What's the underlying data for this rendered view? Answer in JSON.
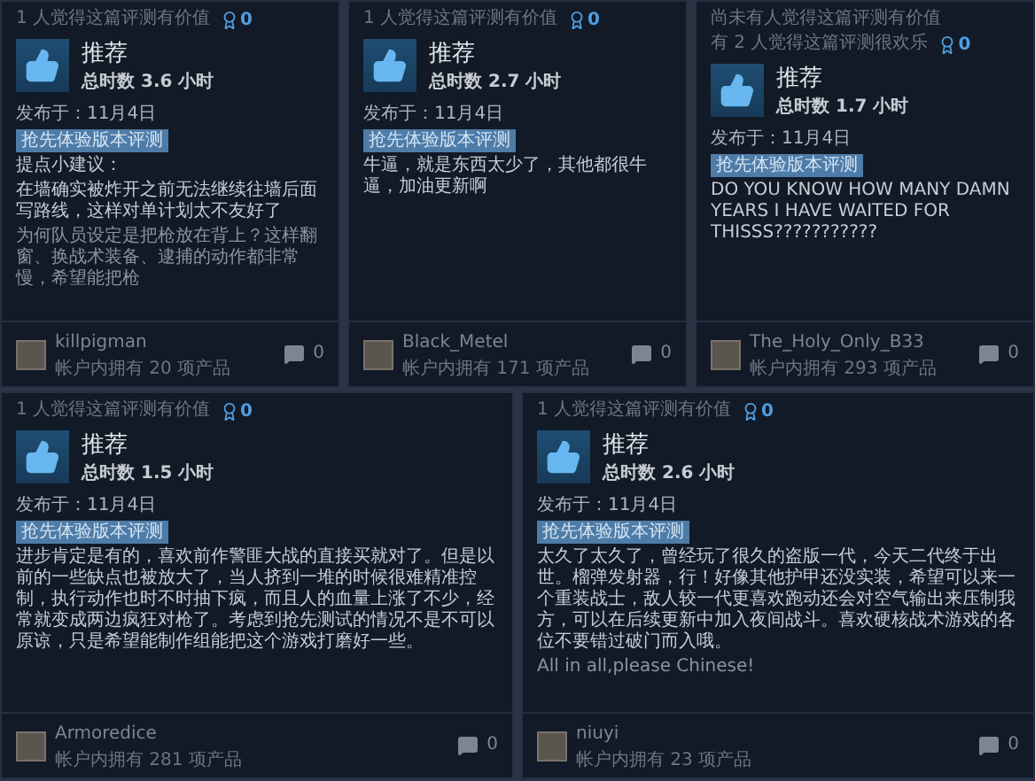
{
  "rows": [
    {
      "reviews": [
        {
          "helpful": [
            "1 人觉得这篇评测有价值"
          ],
          "awards": "0",
          "verdict": "推荐",
          "hours": "总时数 3.6 小时",
          "posted": "发布于：11月4日",
          "tag": "抢先体验版本评测",
          "body": [
            {
              "text": "提点小建议：",
              "faded": false
            },
            {
              "text": "在墙确实被炸开之前无法继续往墙后面写路线，这样对单计划太不友好了",
              "faded": false
            },
            {
              "text": "为何队员设定是把枪放在背上？这样翻窗、换战术装备、逮捕的动作都非常慢，希望能把枪",
              "faded": true
            }
          ],
          "author": "killpigman",
          "products": "帐户内拥有 20 项产品",
          "comments": "0"
        },
        {
          "helpful": [
            "1 人觉得这篇评测有价值"
          ],
          "awards": "0",
          "verdict": "推荐",
          "hours": "总时数 2.7 小时",
          "posted": "发布于：11月4日",
          "tag": "抢先体验版本评测",
          "body": [
            {
              "text": "牛逼，就是东西太少了，其他都很牛逼，加油更新啊",
              "faded": false
            }
          ],
          "author": "Black_Metel",
          "products": "帐户内拥有 171 项产品",
          "comments": "0"
        },
        {
          "helpful": [
            "尚未有人觉得这篇评测有价值",
            "有 2 人觉得这篇评测很欢乐"
          ],
          "awards": "0",
          "verdict": "推荐",
          "hours": "总时数 1.7 小时",
          "posted": "发布于：11月4日",
          "tag": "抢先体验版本评测",
          "body": [
            {
              "text": "DO YOU KNOW HOW MANY DAMN YEARS I HAVE WAITED FOR THISSS???????????",
              "faded": false
            }
          ],
          "author": "The_Holy_Only_B33",
          "products": "帐户内拥有 293 项产品",
          "comments": "0"
        }
      ]
    },
    {
      "reviews": [
        {
          "helpful": [
            "1 人觉得这篇评测有价值"
          ],
          "awards": "0",
          "verdict": "推荐",
          "hours": "总时数 1.5 小时",
          "posted": "发布于：11月4日",
          "tag": "抢先体验版本评测",
          "body": [
            {
              "text": "进步肯定是有的，喜欢前作警匪大战的直接买就对了。但是以前的一些缺点也被放大了，当人挤到一堆的时候很难精准控制，执行动作也时不时抽下疯，而且人的血量上涨了不少，经常就变成两边疯狂对枪了。考虑到抢先测试的情况不是不可以原谅，只是希望能制作组能把这个游戏打磨好一些。",
              "faded": false
            }
          ],
          "author": "Armoredice",
          "products": "帐户内拥有 281 项产品",
          "comments": "0"
        },
        {
          "helpful": [
            "1 人觉得这篇评测有价值"
          ],
          "awards": "0",
          "verdict": "推荐",
          "hours": "总时数 2.6 小时",
          "posted": "发布于：11月4日",
          "tag": "抢先体验版本评测",
          "body": [
            {
              "text": "太久了太久了，曾经玩了很久的盗版一代，今天二代终于出世。榴弹发射器，行！好像其他护甲还没实装，希望可以来一个重装战士，敌人较一代更喜欢跑动还会对空气输出来压制我方，可以在后续更新中加入夜间战斗。喜欢硬核战术游戏的各位不要错过破门而入哦。",
              "faded": false
            },
            {
              "text": "All in all,please Chinese!",
              "faded": true
            }
          ],
          "author": "niuyi",
          "products": "帐户内拥有 23 项产品",
          "comments": "0"
        }
      ]
    }
  ]
}
